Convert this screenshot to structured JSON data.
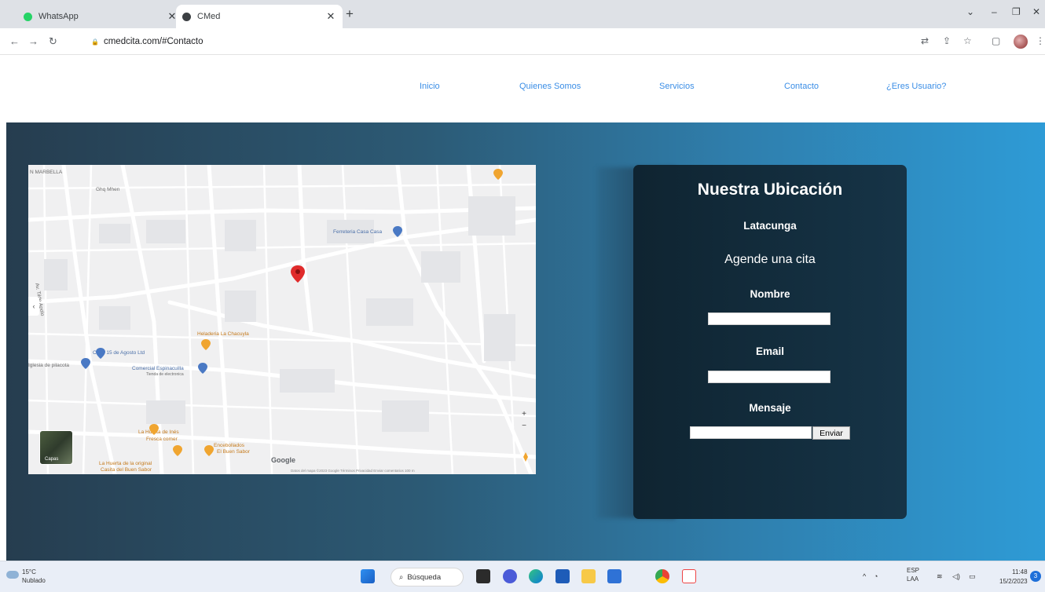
{
  "browser": {
    "tabs": [
      {
        "title": "WhatsApp",
        "favicon_color": "#25d366"
      },
      {
        "title": "CMed",
        "favicon_color": "#3c4043"
      }
    ],
    "new_tab_symbol": "+",
    "url": "cmedcita.com/#Contacto"
  },
  "site_nav": {
    "links": [
      "Inicio",
      "Quienes Somos",
      "Servicios",
      "Contacto",
      "¿Eres Usuario?"
    ]
  },
  "map": {
    "labels": {
      "marbella": "N MARBELLA",
      "street1": "Ghq Mhen",
      "ferreteria": "Ferreteria Casa Casa",
      "avenue": "Av. Tilde Apolo",
      "heladeria": "Heladeria La Chacuyla",
      "coop": "Coop 15 de Agosto Ltd",
      "iglesia": "Iglesia de pilacota",
      "comercial": "Comercial Espinacuilla",
      "comercial_sub": "Tienda de electronica",
      "huerta1": "La Huerta de Inés",
      "huerta1_sub": "Fresca comer",
      "encebollado": "Encebollados",
      "encebollado_sub": "El Buen Sabor",
      "huerta2": "La Huerta de la original",
      "huerta2_sub": "Casita del Buen Sabor"
    },
    "google_label": "Google",
    "footer": "Datos del mapa ©2023   Google   Términos   Privacidad   Enviar comentarios   100 m",
    "satellite_label": "Capas"
  },
  "location_card": {
    "heading": "Nuestra Ubicación",
    "city": "Latacunga",
    "subheading": "Agende una cita",
    "name_label": "Nombre",
    "email_label": "Email",
    "message_label": "Mensaje",
    "send_button": "Enviar"
  },
  "taskbar": {
    "temperature": "15°C",
    "weather": "Nublado",
    "search_label": "Búsqueda",
    "lang_top": "ESP",
    "lang_bottom": "LAA",
    "time": "11:48",
    "date": "15/2/2023"
  }
}
